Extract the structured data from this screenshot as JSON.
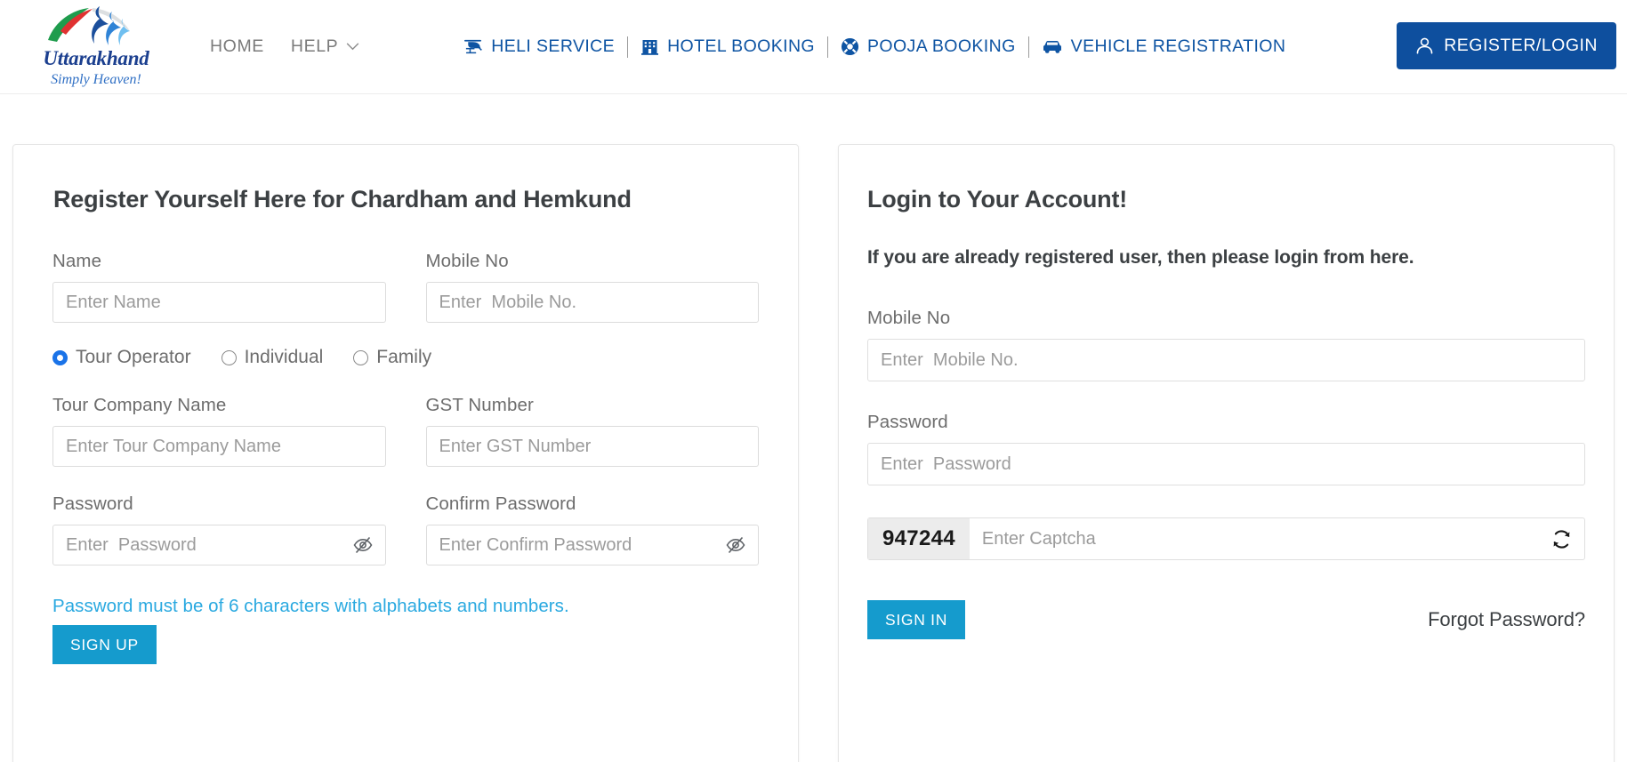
{
  "header": {
    "logo": {
      "name": "Uttarakhand",
      "tagline": "Simply Heaven!",
      "icon": "uttarakhand-tourism-logo"
    },
    "primary_nav": [
      {
        "label": "HOME",
        "icon": null,
        "has_dropdown": false
      },
      {
        "label": "HELP",
        "icon": "chevron-down-icon",
        "has_dropdown": true
      }
    ],
    "secondary_nav": [
      {
        "label": "HELI SERVICE",
        "icon": "helicopter-icon"
      },
      {
        "label": "HOTEL BOOKING",
        "icon": "hotel-icon"
      },
      {
        "label": "POOJA BOOKING",
        "icon": "pooja-wheel-icon"
      },
      {
        "label": "VEHICLE REGISTRATION",
        "icon": "car-icon"
      }
    ],
    "register_login_button": {
      "label": "REGISTER/LOGIN",
      "icon": "user-icon"
    }
  },
  "register_panel": {
    "title": "Register Yourself Here for Chardham and Hemkund",
    "fields": {
      "name": {
        "label": "Name",
        "placeholder": "Enter Name",
        "value": ""
      },
      "mobile": {
        "label": "Mobile No",
        "placeholder": "Enter  Mobile No.",
        "value": ""
      },
      "company": {
        "label": "Tour Company Name",
        "placeholder": "Enter Tour Company Name",
        "value": ""
      },
      "gst": {
        "label": "GST Number",
        "placeholder": "Enter GST Number",
        "value": ""
      },
      "password": {
        "label": "Password",
        "placeholder": "Enter  Password",
        "value": ""
      },
      "confirm_password": {
        "label": "Confirm Password",
        "placeholder": "Enter Confirm Password",
        "value": ""
      }
    },
    "user_types": [
      {
        "label": "Tour Operator",
        "selected": true
      },
      {
        "label": "Individual",
        "selected": false
      },
      {
        "label": "Family",
        "selected": false
      }
    ],
    "password_hint": "Password must be of 6 characters with alphabets and numbers.",
    "sign_up_label": "SIGN UP"
  },
  "login_panel": {
    "title": "Login to Your Account!",
    "subtitle": "If you are already registered user, then please login from here.",
    "fields": {
      "mobile": {
        "label": "Mobile No",
        "placeholder": "Enter  Mobile No.",
        "value": ""
      },
      "password": {
        "label": "Password",
        "placeholder": "Enter  Password",
        "value": ""
      }
    },
    "captcha": {
      "code": "947244",
      "placeholder": "Enter Captcha",
      "value": "",
      "refresh_icon": "refresh-icon"
    },
    "sign_in_label": "SIGN IN",
    "forgot_password_label": "Forgot Password?"
  },
  "colors": {
    "brand_blue": "#0e4f9e",
    "nav_link_blue": "#0e54a3",
    "cta_cyan": "#159bcd",
    "hint_cyan": "#2aa9e0",
    "radio_selected": "#1a73e8",
    "text_dark": "#3c4043",
    "text_muted": "#6d6d6d"
  }
}
